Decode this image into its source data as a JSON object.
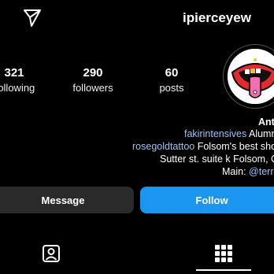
{
  "header": {
    "username": "ipierceyew",
    "icons": {
      "send": "paper-plane-icon"
    }
  },
  "stats": {
    "following_count": "321",
    "following_label": "following",
    "followers_count": "290",
    "followers_label": "followers",
    "posts_count": "60",
    "posts_label": "posts"
  },
  "bio": {
    "name": "Anti",
    "line1_link": "fakirintensives",
    "line1_text": " Alumni",
    "line2_link": "rosegoldtattoo",
    "line2_text": " Folsom's best shop",
    "line3": "Sutter st. suite k Folsom, CA",
    "line4_prefix": "Main: ",
    "line4_link": "@terrib"
  },
  "actions": {
    "message_label": "Message",
    "follow_label": "Follow"
  },
  "tabs": {
    "icons": [
      "tagged-photos-icon",
      "grid-icon"
    ],
    "active": "grid-icon"
  },
  "colors": {
    "background": "#000000",
    "follow_button": "#1a95f0",
    "message_button": "#2a2a2a",
    "link": "#9ec2ff"
  }
}
